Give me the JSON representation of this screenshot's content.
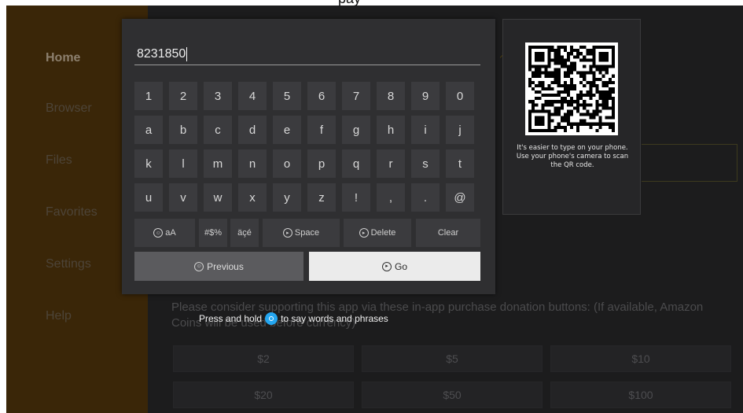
{
  "header": {
    "title": "pay"
  },
  "sidebar": {
    "items": [
      {
        "label": "Home",
        "active": true
      },
      {
        "label": "Browser",
        "active": false
      },
      {
        "label": "Files",
        "active": false
      },
      {
        "label": "Favorites",
        "active": false
      },
      {
        "label": "Settings",
        "active": false
      },
      {
        "label": "Help",
        "active": false
      }
    ]
  },
  "donation": {
    "text": "Please consider supporting this app via these in-app purchase donation buttons: (If available, Amazon Coins will be used before currency)",
    "buttons": [
      "$2",
      "$5",
      "$10",
      "$20",
      "$50",
      "$100"
    ]
  },
  "keyboard": {
    "input_value": "8231850",
    "rows": [
      [
        "1",
        "2",
        "3",
        "4",
        "5",
        "6",
        "7",
        "8",
        "9",
        "0"
      ],
      [
        "a",
        "b",
        "c",
        "d",
        "e",
        "f",
        "g",
        "h",
        "i",
        "j"
      ],
      [
        "k",
        "l",
        "m",
        "n",
        "o",
        "p",
        "q",
        "r",
        "s",
        "t"
      ],
      [
        "u",
        "v",
        "w",
        "x",
        "y",
        "z",
        "!",
        ",",
        ".",
        "@"
      ]
    ],
    "function_keys": {
      "case_label": "aA",
      "symbols_label": "#$%",
      "accents_label": "äçé",
      "space_label": "Space",
      "delete_label": "Delete",
      "clear_label": "Clear"
    },
    "previous_label": "Previous",
    "go_label": "Go"
  },
  "qr": {
    "hint": "It's easier to type on your phone. Use your phone's camera to scan the QR code."
  },
  "voice": {
    "text": "Press and hold",
    "text2": "to say words and phrases"
  },
  "colors": {
    "sidebar": "#3a2608",
    "background": "#1c1c1d",
    "keyboard_panel": "#2f2f31",
    "key": "#3b3b3e",
    "go_button": "#ebebeb",
    "mic_blue": "#24a6f0"
  },
  "icons": {
    "case": "smiley-button-icon",
    "space": "play-button-icon",
    "delete": "play-button-icon",
    "previous": "smiley-button-icon",
    "go": "play-button-icon",
    "voice": "microphone-icon"
  }
}
